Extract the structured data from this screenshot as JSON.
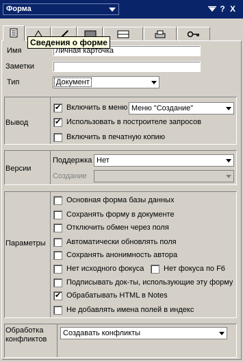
{
  "title_bar": {
    "selector_value": "Форма",
    "buttons": [
      "pin-icon",
      "?",
      "X"
    ]
  },
  "tabs": {
    "tooltip": "Сведения о форме",
    "icons": [
      "form-info-icon",
      "launch-icon",
      "rocket-icon",
      "background-icon",
      "layout-icon",
      "print-icon",
      "key-icon"
    ]
  },
  "basic": {
    "name_label": "Имя",
    "name_value": "Личная карточка",
    "notes_label": "Заметки",
    "notes_value": "",
    "type_label": "Тип",
    "type_value": "Документ"
  },
  "output": {
    "label": "Вывод",
    "include_menu_label": "Включить в меню",
    "include_menu_checked": true,
    "include_menu_value": "Меню \"Создание\"",
    "query_builder_label": "Использовать в построителе запросов",
    "query_builder_checked": true,
    "print_copy_label": "Включить в печатную копию",
    "print_copy_checked": false
  },
  "versions": {
    "label": "Версии",
    "support_label": "Поддержка",
    "support_value": "Нет",
    "create_label": "Создание",
    "create_value": ""
  },
  "params": {
    "label": "Параметры",
    "items": [
      {
        "label": "Основная форма базы данных",
        "checked": false
      },
      {
        "label": "Сохранять форму в документе",
        "checked": false
      },
      {
        "label": "Отключить обмен через поля",
        "checked": false
      },
      {
        "label": "Автоматически обновлять поля",
        "checked": false
      },
      {
        "label": "Сохранять анонимность автора",
        "checked": false
      },
      {
        "label": "Нет исходного фокуса",
        "checked": false
      },
      {
        "label": "Нет фокуса по F6",
        "checked": false
      },
      {
        "label": "Подписывать док-ты, использующие эту форму",
        "checked": false
      },
      {
        "label": "Обрабатывать HTML в Notes",
        "checked": true
      },
      {
        "label": "Не добавлять имена полей в индекс",
        "checked": false
      }
    ]
  },
  "conflicts": {
    "label_line1": "Обработка",
    "label_line2": "конфликтов",
    "value": "Создавать конфликты"
  }
}
